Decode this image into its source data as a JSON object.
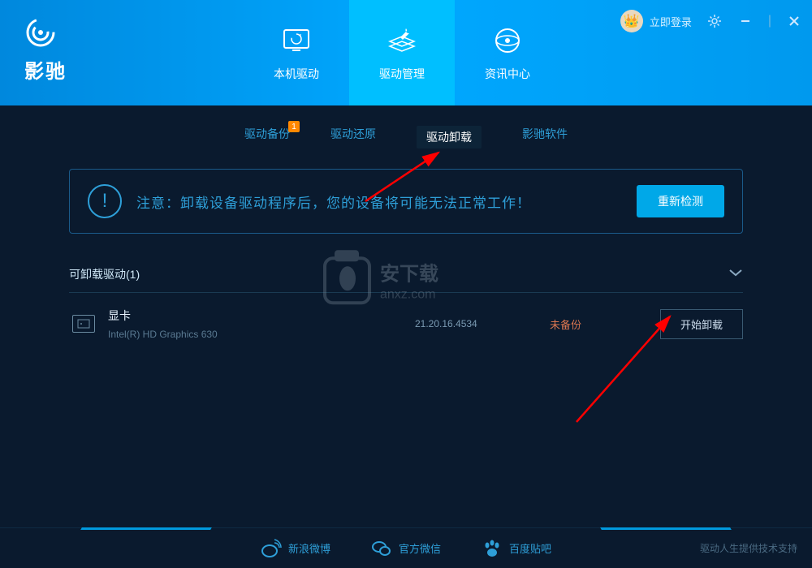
{
  "brand": "影驰",
  "header": {
    "login_text": "立即登录",
    "tabs": [
      {
        "label": "本机驱动"
      },
      {
        "label": "驱动管理"
      },
      {
        "label": "资讯中心"
      }
    ]
  },
  "sub_tabs": [
    {
      "label": "驱动备份",
      "badge": "1"
    },
    {
      "label": "驱动还原"
    },
    {
      "label": "驱动卸载"
    },
    {
      "label": "影驰软件"
    }
  ],
  "warning": {
    "text": "注意：卸载设备驱动程序后，您的设备将可能无法正常工作！",
    "button": "重新检测"
  },
  "section": {
    "title": "可卸载驱动(1)"
  },
  "driver": {
    "name": "显卡",
    "model": "Intel(R) HD Graphics 630",
    "version": "21.20.16.4534",
    "status": "未备份",
    "action": "开始卸载"
  },
  "watermark": "安下载 anxz.com",
  "footer": {
    "socials": [
      {
        "label": "新浪微博"
      },
      {
        "label": "官方微信"
      },
      {
        "label": "百度贴吧"
      }
    ],
    "credit": "驱动人生提供技术支持"
  }
}
